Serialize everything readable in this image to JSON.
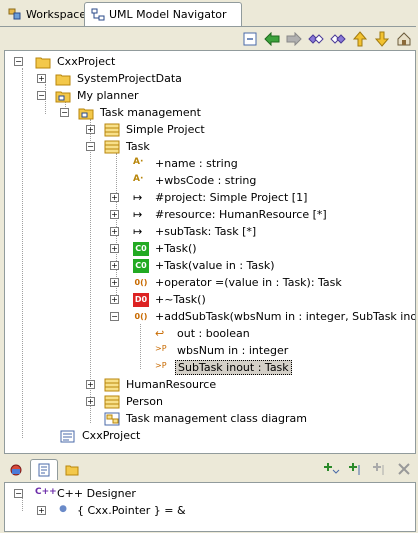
{
  "tabs": [
    {
      "label": "Workspace",
      "icon": "workspace-icon"
    },
    {
      "label": "UML Model Navigator",
      "icon": "uml-navigator-icon"
    }
  ],
  "toolbar": [
    "collapse-all-icon",
    "back-icon",
    "forward-icon",
    "link-left-icon",
    "link-right-icon",
    "up-icon",
    "down-icon",
    "home-icon"
  ],
  "tree": {
    "root": "CxxProject",
    "system_project_data": "SystemProjectData",
    "my_planner": "My planner",
    "task_management": "Task management",
    "simple_project": "Simple Project",
    "task": "Task",
    "members": [
      {
        "label": "+name : string",
        "icon": "attribute-icon"
      },
      {
        "label": "+wbsCode : string",
        "icon": "attribute-icon"
      },
      {
        "label": "#project: Simple Project [1]",
        "icon": "association-icon"
      },
      {
        "label": "#resource: HumanResource [*]",
        "icon": "association-icon"
      },
      {
        "label": "+subTask: Task [*]",
        "icon": "association-icon"
      },
      {
        "label": "+Task()",
        "icon": "constructor-icon"
      },
      {
        "label": "+Task(value in : Task)",
        "icon": "constructor-icon"
      },
      {
        "label": "+operator =(value in : Task): Task",
        "icon": "operation-icon"
      },
      {
        "label": "+~Task()",
        "icon": "destructor-icon"
      },
      {
        "label": "+addSubTask(wbsNum in : integer, SubTask inout : Ta",
        "icon": "operation-icon"
      }
    ],
    "params": [
      {
        "label": "out : boolean",
        "icon": "return-icon"
      },
      {
        "label": "wbsNum in : integer",
        "icon": "parameter-icon"
      },
      {
        "label": "SubTask inout : Task",
        "icon": "parameter-icon"
      }
    ],
    "human_resource": "HumanResource",
    "person": "Person",
    "class_diagram": "Task management class diagram",
    "cxx_project_model": "CxxProject"
  },
  "bottom": {
    "tabs": [
      "properties-icon",
      "outline-icon",
      "notes-icon"
    ],
    "tools": [
      "add-icon",
      "add-child-icon",
      "add-disabled-icon",
      "delete-icon"
    ],
    "designer": "C++ Designer",
    "pointer": "{ Cxx.Pointer } = &"
  },
  "colors": {
    "selection": "#d4d0c8",
    "folder": "#f3c84a",
    "constructor": "#22aa22",
    "destructor": "#dd2222"
  }
}
